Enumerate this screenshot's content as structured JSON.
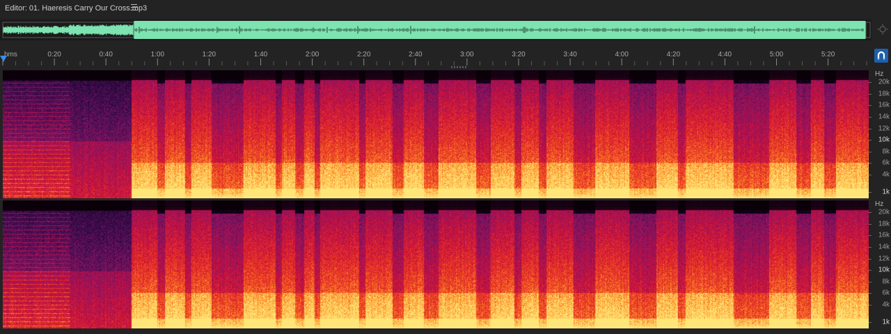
{
  "window": {
    "title": "Editor: 01. Haeresis Carry Our Cross.mp3",
    "menu_icon": "hamburger-menu-icon"
  },
  "overview": {
    "waveform_color": "#7de3b0",
    "zoom_icon": "zoom-navigator-icon"
  },
  "ruler": {
    "unit_label": "hms",
    "ticks": [
      "0:20",
      "0:40",
      "1:00",
      "1:20",
      "1:40",
      "2:00",
      "2:20",
      "2:40",
      "3:00",
      "3:20",
      "3:40",
      "4:00",
      "4:20",
      "4:40",
      "5:00",
      "5:20"
    ],
    "snap_icon": "magnet-snap-icon",
    "accent_color": "#3a8ee6"
  },
  "frequency_axis": {
    "unit": "Hz",
    "labels": [
      {
        "text": "20k",
        "hz": 20000
      },
      {
        "text": "18k",
        "hz": 18000
      },
      {
        "text": "16k",
        "hz": 16000
      },
      {
        "text": "14k",
        "hz": 14000
      },
      {
        "text": "12k",
        "hz": 12000
      },
      {
        "text": "10k",
        "hz": 10000,
        "strong": true
      },
      {
        "text": "8k",
        "hz": 8000
      },
      {
        "text": "6k",
        "hz": 6000
      },
      {
        "text": "4k",
        "hz": 4000
      },
      {
        "text": "1k",
        "hz": 1000,
        "strong": true
      }
    ]
  },
  "spectrogram": {
    "channels": [
      "channel-1",
      "channel-2"
    ],
    "colors": {
      "low": "#0a0008",
      "mid": "#d0103a",
      "high": "#ffd86a"
    }
  }
}
